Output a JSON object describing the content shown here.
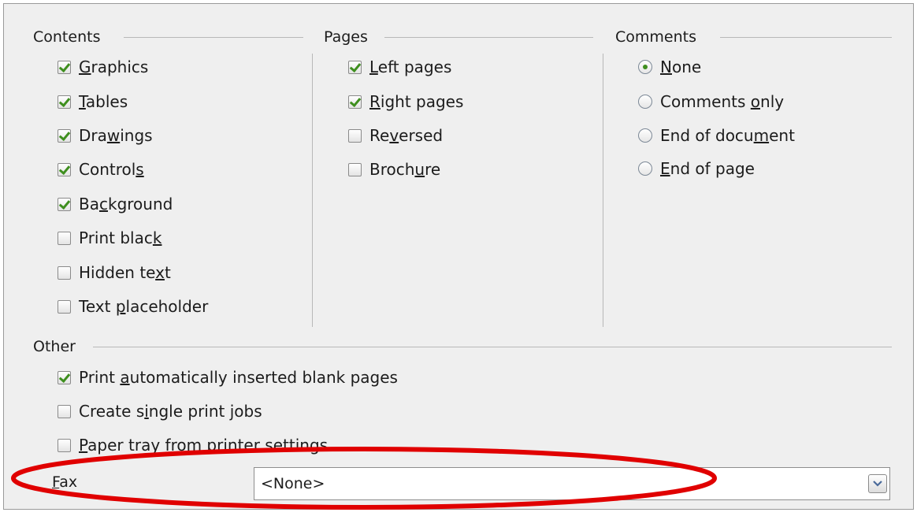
{
  "sections": {
    "contents": {
      "title": "Contents",
      "items": [
        {
          "pre": "",
          "key": "G",
          "post": "raphics",
          "checked": true
        },
        {
          "pre": "",
          "key": "T",
          "post": "ables",
          "checked": true
        },
        {
          "pre": "Dra",
          "key": "w",
          "post": "ings",
          "checked": true
        },
        {
          "pre": "Control",
          "key": "s",
          "post": "",
          "checked": true
        },
        {
          "pre": "Ba",
          "key": "c",
          "post": "kground",
          "checked": true
        },
        {
          "pre": "Print blac",
          "key": "k",
          "post": "",
          "checked": false
        },
        {
          "pre": "Hidden te",
          "key": "x",
          "post": "t",
          "checked": false
        },
        {
          "pre": "Text ",
          "key": "p",
          "post": "laceholder",
          "checked": false
        }
      ]
    },
    "pages": {
      "title": "Pages",
      "items": [
        {
          "pre": "",
          "key": "L",
          "post": "eft pages",
          "checked": true
        },
        {
          "pre": "",
          "key": "R",
          "post": "ight pages",
          "checked": true
        },
        {
          "pre": "Re",
          "key": "v",
          "post": "ersed",
          "checked": false
        },
        {
          "pre": "Broch",
          "key": "u",
          "post": "re",
          "checked": false
        }
      ]
    },
    "comments": {
      "title": "Comments",
      "items": [
        {
          "pre": "",
          "key": "N",
          "post": "one",
          "selected": true
        },
        {
          "pre": "Comments ",
          "key": "o",
          "post": "nly",
          "selected": false
        },
        {
          "pre": "End of docu",
          "key": "m",
          "post": "ent",
          "selected": false
        },
        {
          "pre": "",
          "key": "E",
          "post": "nd of page",
          "selected": false
        }
      ]
    },
    "other": {
      "title": "Other",
      "items": [
        {
          "pre": "Print ",
          "key": "a",
          "post": "utomatically inserted blank pages",
          "checked": true
        },
        {
          "pre": "Create s",
          "key": "i",
          "post": "ngle print jobs",
          "checked": false
        },
        {
          "pre": "",
          "key": "P",
          "post": "aper tray from printer settings",
          "checked": false
        }
      ]
    }
  },
  "fax": {
    "label_key": "F",
    "label_rest": "ax",
    "value": "<None>"
  },
  "colors": {
    "check": "#3f8f1f",
    "annotation": "#e00000"
  }
}
